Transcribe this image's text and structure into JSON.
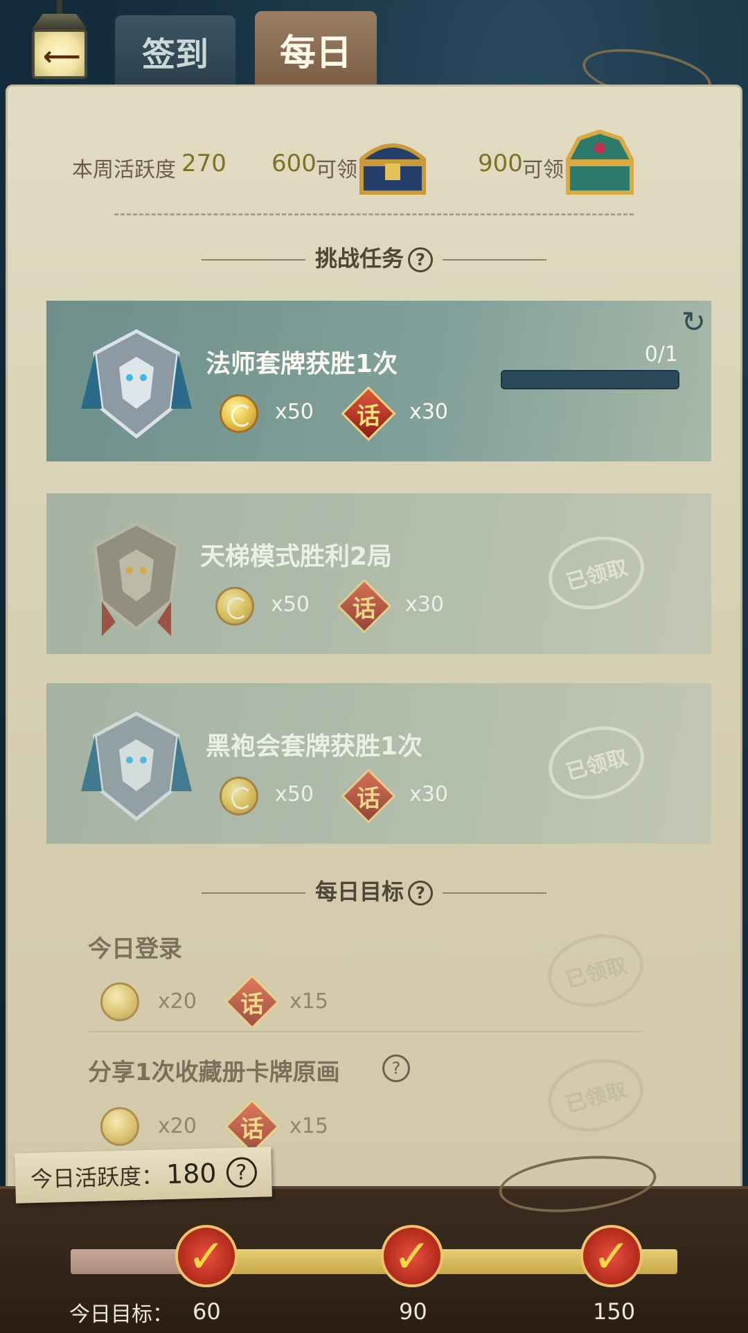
{
  "header": {
    "back_icon": "arrow-left-icon",
    "tabs": [
      {
        "label": "签到",
        "active": false
      },
      {
        "label": "每日",
        "active": true
      }
    ]
  },
  "weekly": {
    "label": "本周活跃度",
    "value": "270",
    "reward1_threshold": "600",
    "reward1_suffix": "可领",
    "reward2_threshold": "900",
    "reward2_suffix": "可领"
  },
  "challenge_section": {
    "title": "挑战任务"
  },
  "challenge_tasks": [
    {
      "title": "法师套牌获胜1次",
      "progress_text": "0/1",
      "progress": 0,
      "coin": "x50",
      "rune": "x30",
      "claimed": false
    },
    {
      "title": "天梯模式胜利2局",
      "coin": "x50",
      "rune": "x30",
      "claimed": true,
      "stamp": "已领取"
    },
    {
      "title": "黑袍会套牌获胜1次",
      "coin": "x50",
      "rune": "x30",
      "claimed": true,
      "stamp": "已领取"
    }
  ],
  "daily_section": {
    "title": "每日目标"
  },
  "daily_goals": [
    {
      "title": "今日登录",
      "coin": "x20",
      "rune": "x15",
      "stamp": "已领取"
    },
    {
      "title": "分享1次收藏册卡牌原画",
      "coin": "x20",
      "rune": "x15",
      "stamp": "已领取"
    }
  ],
  "footer": {
    "activity_label": "今日活跃度：",
    "activity_value": "180",
    "goal_label": "今日目标：",
    "milestones": [
      "60",
      "90",
      "150"
    ],
    "rune_glyph": "话",
    "check_glyph": "✓"
  },
  "colors": {
    "accent_gold": "#e5cf78",
    "card_teal": "#6e8f8a",
    "rune_red": "#b02a1c"
  }
}
